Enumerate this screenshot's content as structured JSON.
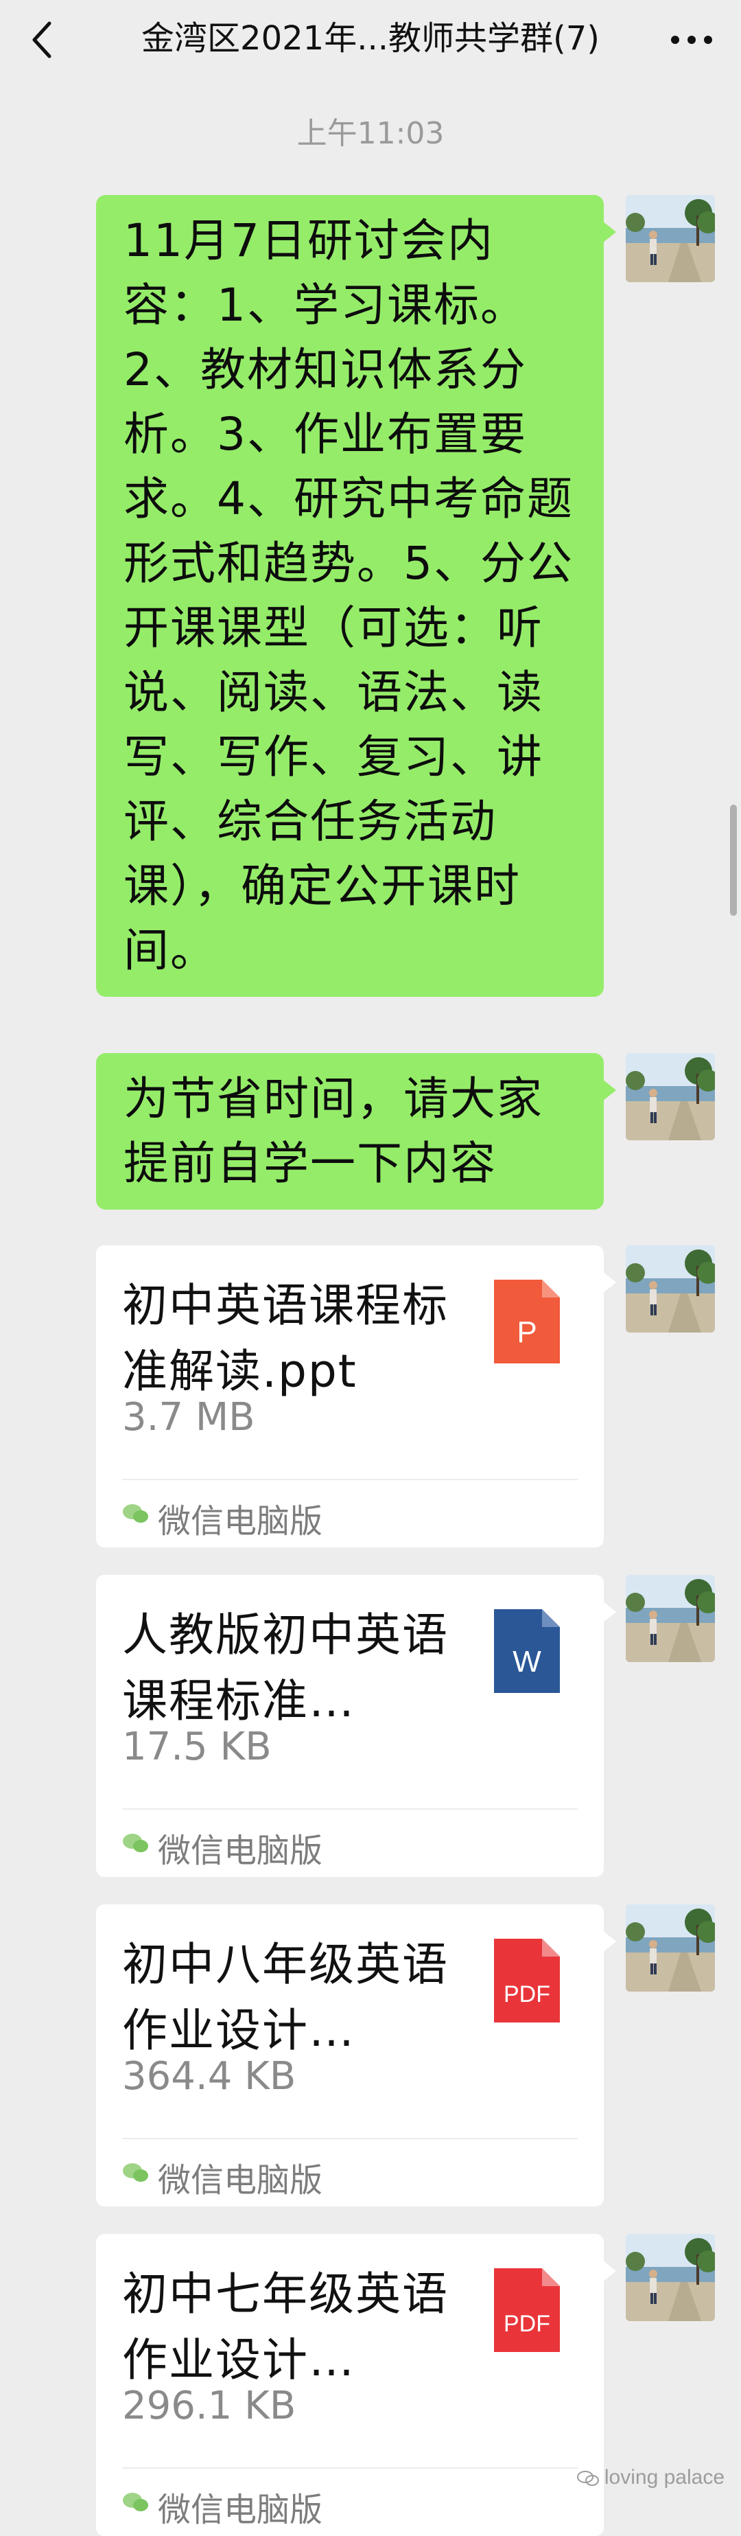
{
  "header": {
    "title": "金湾区2021年...教师共学群(7)",
    "back_icon": "chevron-left-icon",
    "more_icon": "more-dots-icon"
  },
  "timestamp": "上午11:03",
  "messages": [
    {
      "type": "text",
      "text": "11月7日研讨会内容：1、学习课标。2、教材知识体系分析。3、作业布置要求。4、研究中考命题形式和趋势。5、分公开课课型（可选：听说、阅读、语法、读写、写作、复习、讲评、综合任务活动课），确定公开课时间。"
    },
    {
      "type": "text",
      "text": "为节省时间，请大家提前自学一下内容"
    },
    {
      "type": "file",
      "name": "初中英语课程标准解读.ppt",
      "size": "3.7 MB",
      "file_type": "ppt",
      "icon_label": "P",
      "icon_color": "#f15a3b",
      "source": "微信电脑版"
    },
    {
      "type": "file",
      "name": "人教版初中英语课程标准…",
      "size": "17.5 KB",
      "file_type": "doc",
      "icon_label": "W",
      "icon_color": "#2b5797",
      "source": "微信电脑版"
    },
    {
      "type": "file",
      "name": "初中八年级英语作业设计…",
      "size": "364.4 KB",
      "file_type": "pdf",
      "icon_label": "PDF",
      "icon_color": "#e9353a",
      "source": "微信电脑版"
    },
    {
      "type": "file",
      "name": "初中七年级英语作业设计…",
      "size": "296.1 KB",
      "file_type": "pdf",
      "icon_label": "PDF",
      "icon_color": "#e9353a",
      "source": "微信电脑版"
    }
  ],
  "colors": {
    "background": "#ededed",
    "bubble_green": "#95ec69",
    "card_white": "#ffffff",
    "secondary_text": "#8a8a8a"
  },
  "watermark": "loving palace"
}
